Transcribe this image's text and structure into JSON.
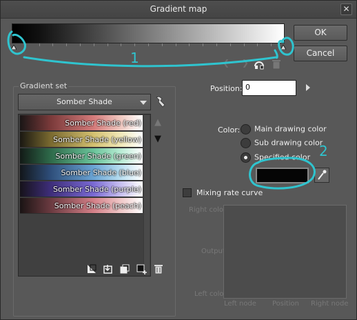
{
  "window": {
    "title": "Gradient map",
    "close_glyph": "✕"
  },
  "buttons": {
    "ok": "OK",
    "cancel": "Cancel"
  },
  "nav": {
    "prev": "❮",
    "next": "❯"
  },
  "gradient_set": {
    "label": "Gradient set",
    "selected": "Somber Shade",
    "items": [
      {
        "label": "Somber Shade (red)",
        "colors": [
          "#1a1616",
          "#7a3a3a",
          "#d47a7a",
          "#f0c8c0",
          "#ffffff"
        ]
      },
      {
        "label": "Somber Shade (yellow)",
        "colors": [
          "#1a1812",
          "#7a6a30",
          "#d4c070",
          "#f0e8b8",
          "#ffffff"
        ]
      },
      {
        "label": "Somber Shade (green)",
        "colors": [
          "#121a16",
          "#2e6a4a",
          "#6ac49a",
          "#b8ecd4",
          "#ffffff"
        ]
      },
      {
        "label": "Somber Shade (blue)",
        "colors": [
          "#12161a",
          "#2e4e7a",
          "#6aa4d4",
          "#b8def0",
          "#ffffff"
        ]
      },
      {
        "label": "Somber Shade (purple)",
        "colors": [
          "#16121a",
          "#3e2e7a",
          "#7a6ad4",
          "#c8c0f0",
          "#ffffff"
        ]
      },
      {
        "label": "Somber Shade (peach)",
        "colors": [
          "#1a1414",
          "#6a3a40",
          "#d48088",
          "#f0c8c8",
          "#ffffff"
        ]
      }
    ]
  },
  "position": {
    "label": "Position:",
    "value": "0"
  },
  "color": {
    "label": "Color:",
    "options": [
      {
        "label": "Main drawing color",
        "selected": false
      },
      {
        "label": "Sub drawing color",
        "selected": false
      },
      {
        "label": "Specified color",
        "selected": true
      }
    ],
    "specified_hex": "#050505"
  },
  "mixing": {
    "label": "Mixing rate curve",
    "checked": false,
    "right_color": "Right color",
    "output": "Output",
    "left_color": "Left color",
    "left_node": "Left node",
    "position": "Position",
    "right_node": "Right node"
  },
  "annotations": {
    "mark1": "1",
    "mark2": "2",
    "color": "#2fc4cf"
  }
}
